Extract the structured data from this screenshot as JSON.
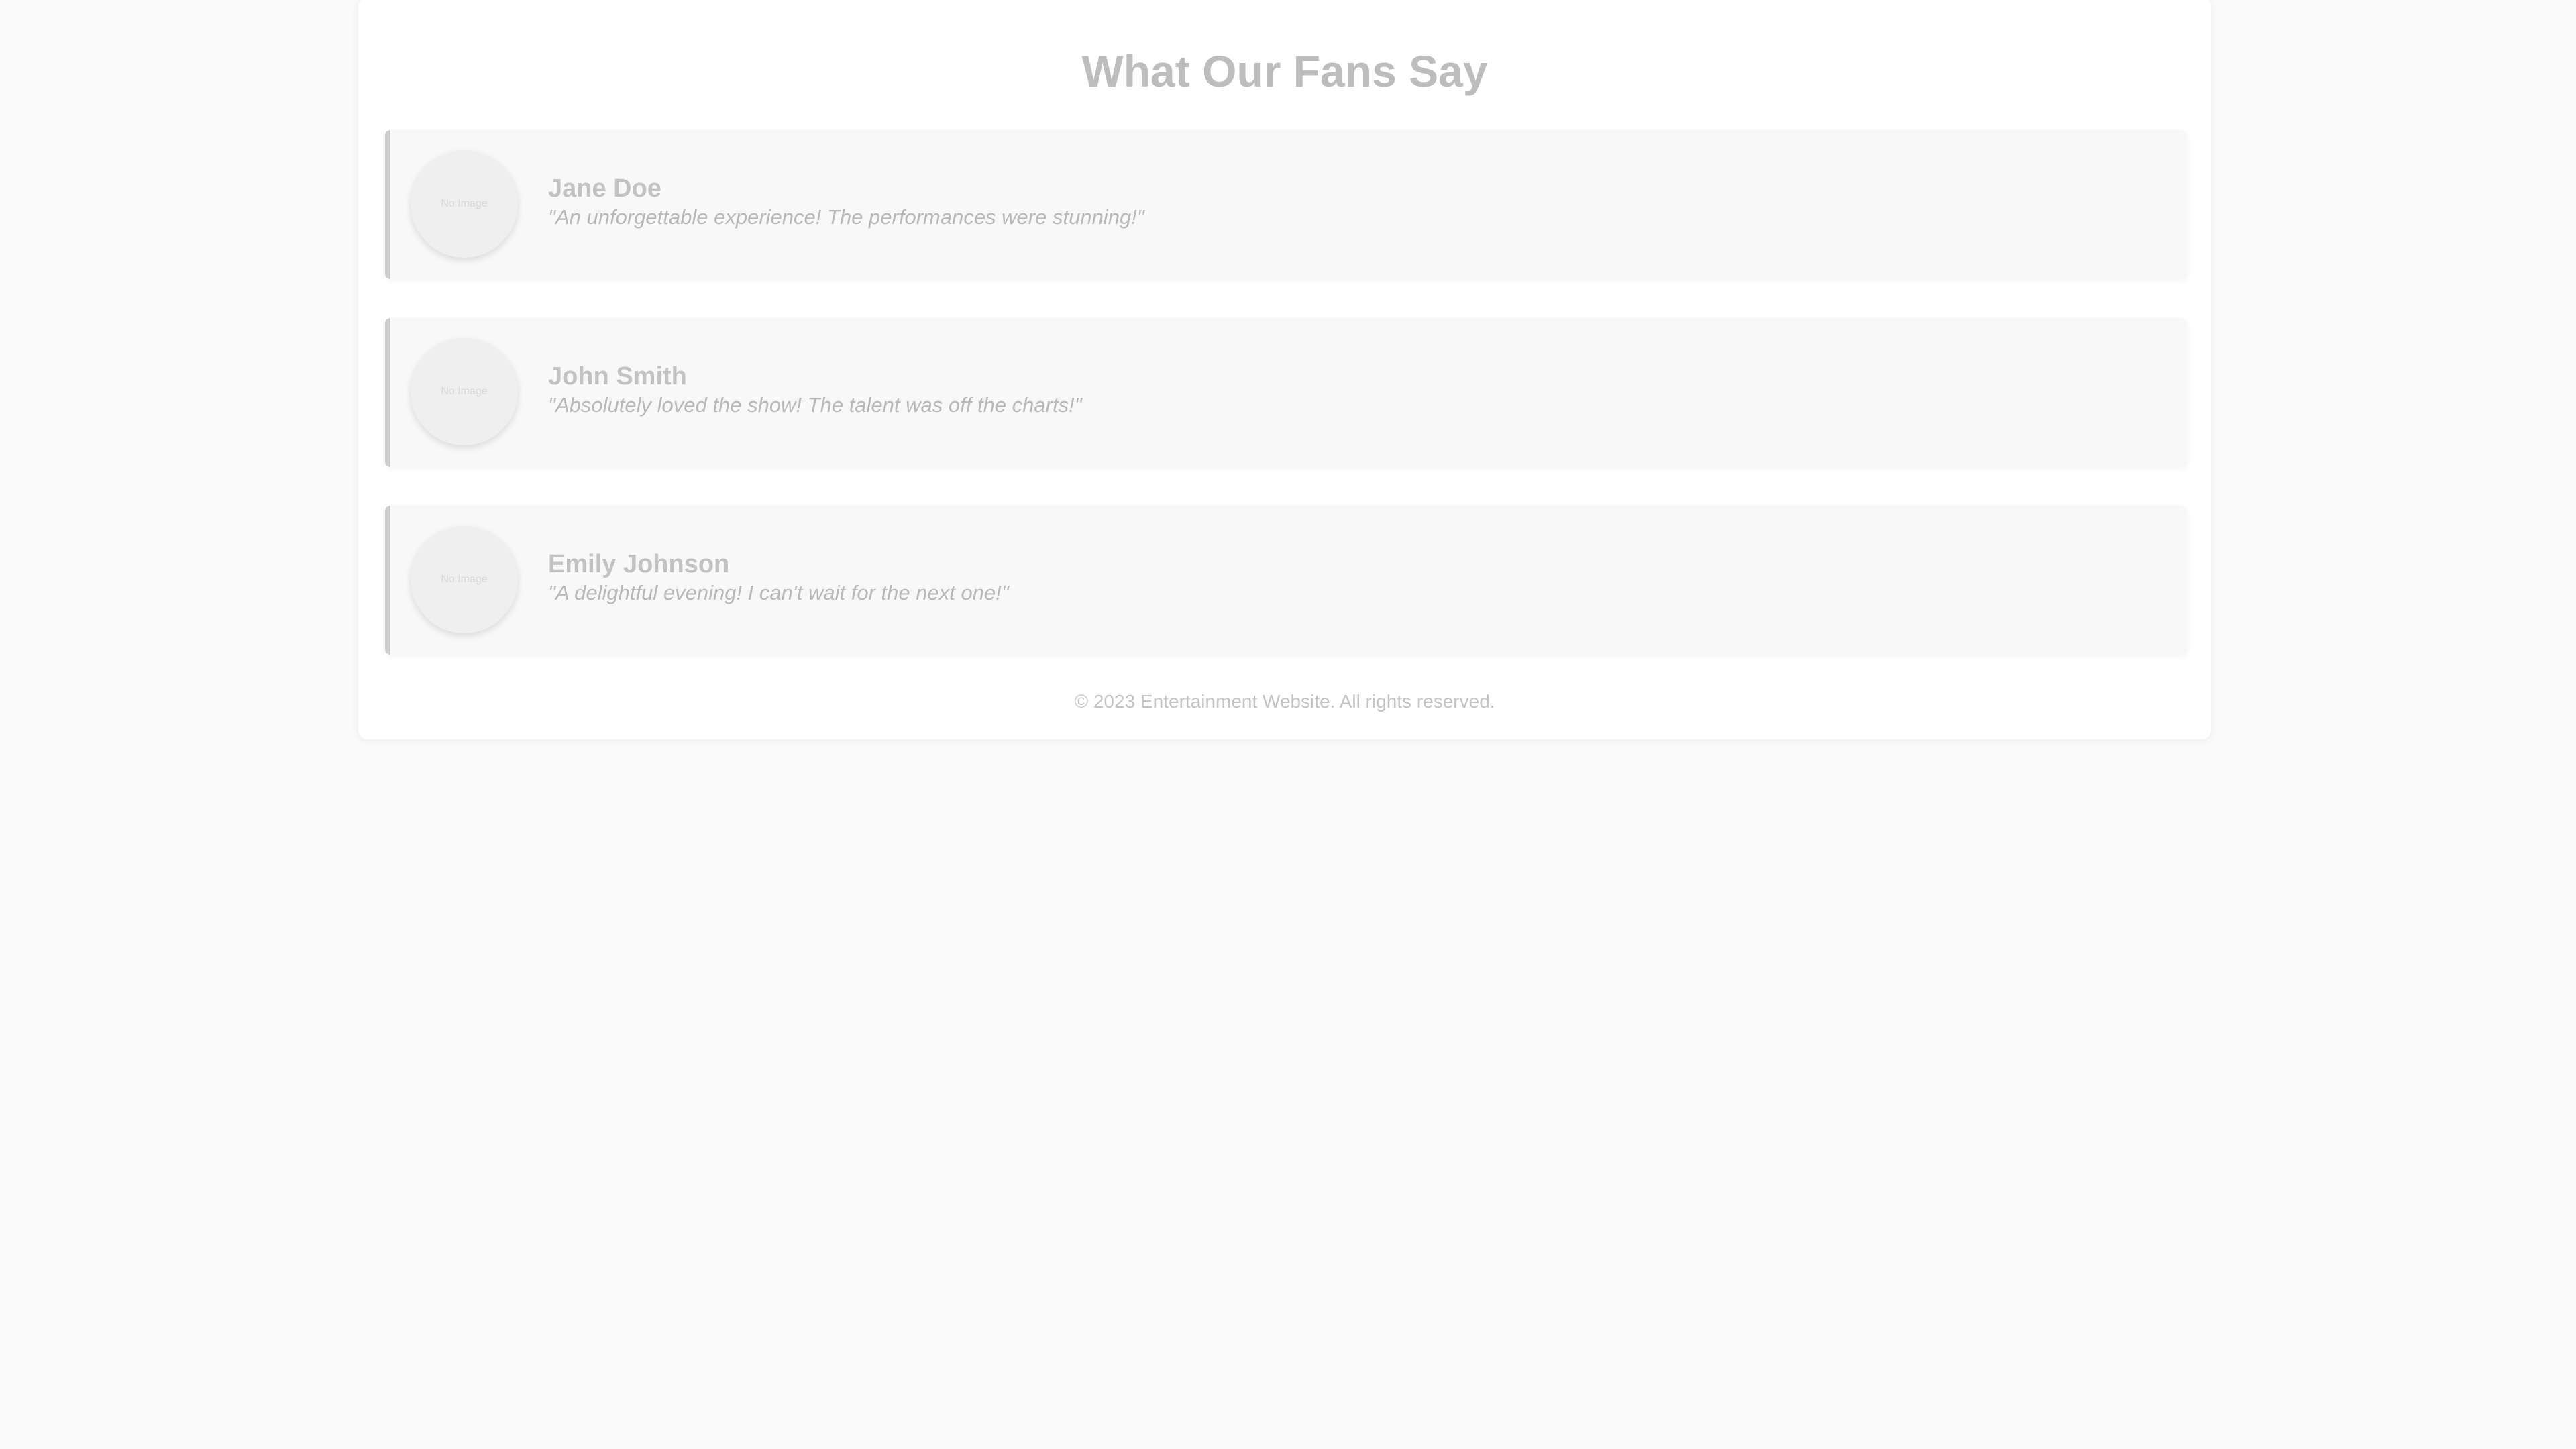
{
  "page": {
    "title": "What Our Fans Say"
  },
  "testimonials": [
    {
      "avatar_label": "No Image",
      "name": "Jane Doe",
      "quote": "\"An unforgettable experience! The performances were stunning!\""
    },
    {
      "avatar_label": "No Image",
      "name": "John Smith",
      "quote": "\"Absolutely loved the show! The talent was off the charts!\""
    },
    {
      "avatar_label": "No Image",
      "name": "Emily Johnson",
      "quote": "\"A delightful evening! I can't wait for the next one!\""
    }
  ],
  "footer": {
    "text": "© 2023 Entertainment Website. All rights reserved."
  },
  "colors": {
    "background": "#fafafa",
    "card": "#ffffff",
    "testimonial_bg": "#f8f8f8",
    "accent_border": "#cccccc"
  }
}
